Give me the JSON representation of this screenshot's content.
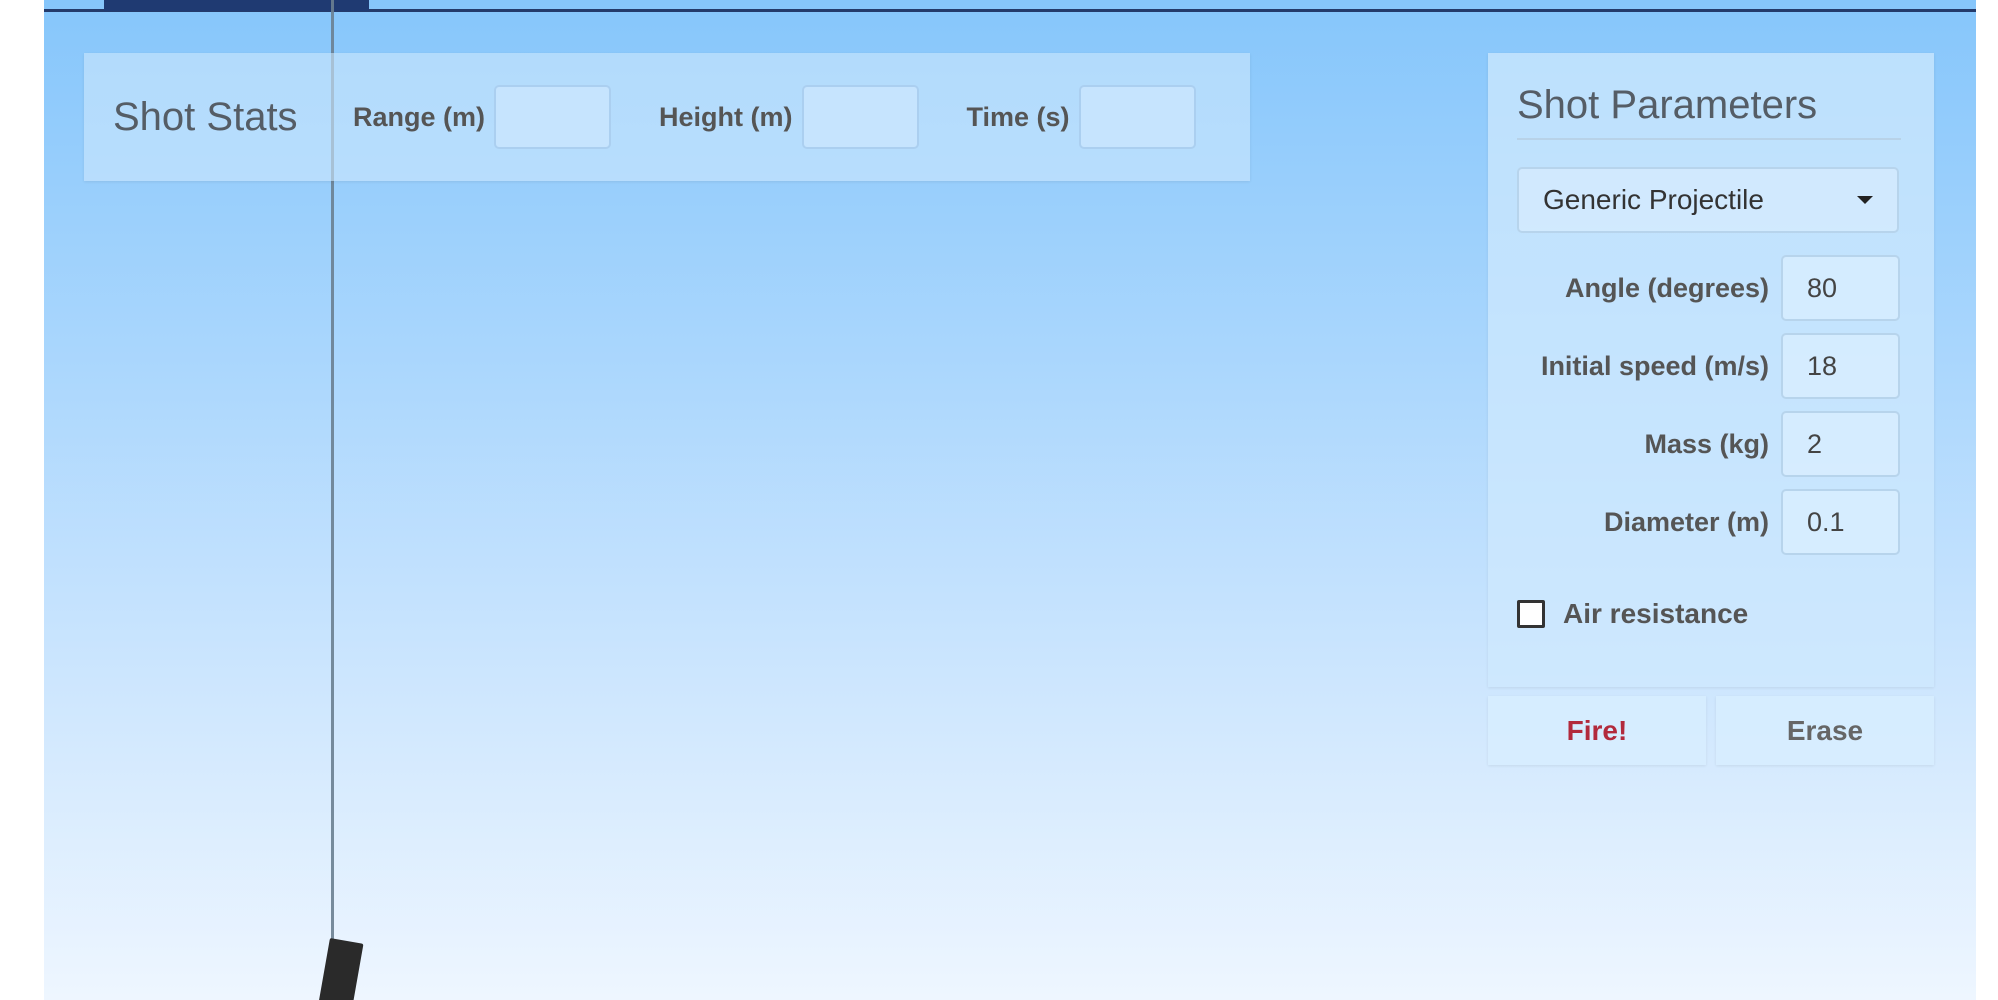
{
  "stats": {
    "title": "Shot Stats",
    "range_label": "Range (m)",
    "range_value": "",
    "height_label": "Height (m)",
    "height_value": "",
    "time_label": "Time (s)",
    "time_value": ""
  },
  "params": {
    "title": "Shot Parameters",
    "projectile_selected": "Generic Projectile",
    "angle_label": "Angle (degrees)",
    "angle_value": "80",
    "speed_label": "Initial speed (m/s)",
    "speed_value": "18",
    "mass_label": "Mass (kg)",
    "mass_value": "2",
    "diameter_label": "Diameter (m)",
    "diameter_value": "0.1",
    "air_resistance_label": "Air resistance",
    "air_resistance_checked": false
  },
  "buttons": {
    "fire_label": "Fire!",
    "erase_label": "Erase"
  },
  "colors": {
    "sky_top": "#86c6fb",
    "sky_bottom": "#eef6ff",
    "fire_text": "#b22a3c",
    "top_bar": "#1f3a72"
  }
}
